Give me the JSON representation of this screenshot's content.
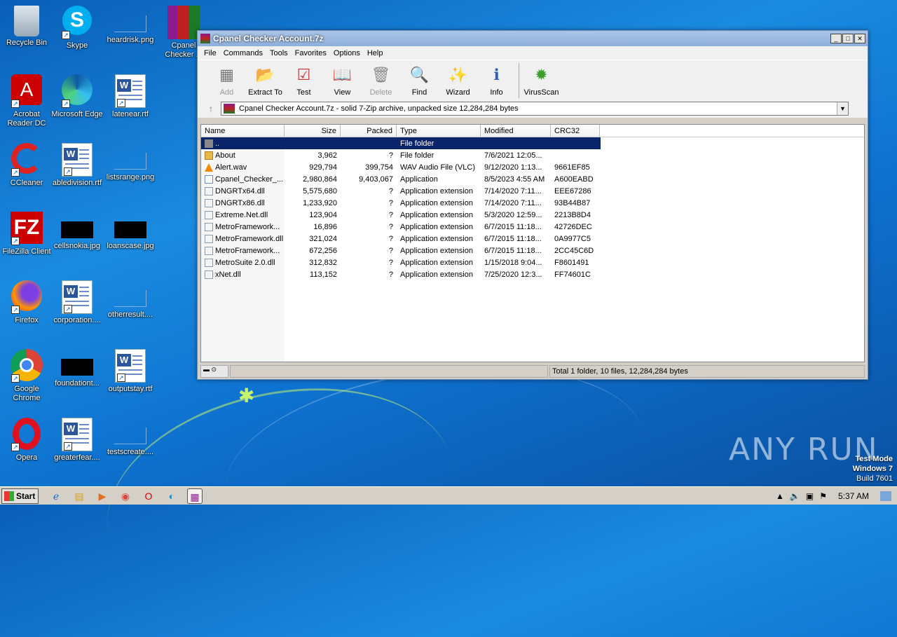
{
  "desktop": {
    "icons": [
      {
        "label": "Recycle Bin",
        "kind": "recycle"
      },
      {
        "label": "Skype",
        "kind": "skype"
      },
      {
        "label": "heardrisk.png",
        "kind": "blank"
      },
      {
        "label": "Cpanel Checker ...",
        "kind": "rar"
      },
      {
        "label": "Acrobat Reader DC",
        "kind": "acrobat"
      },
      {
        "label": "Microsoft Edge",
        "kind": "edge"
      },
      {
        "label": "latenear.rtf",
        "kind": "word"
      },
      {
        "label": "CCleaner",
        "kind": "ccleaner"
      },
      {
        "label": "abledivision.rtf",
        "kind": "word"
      },
      {
        "label": "listsrange.png",
        "kind": "blank"
      },
      {
        "label": "FileZilla Client",
        "kind": "filezilla"
      },
      {
        "label": "cellsnokia.jpg",
        "kind": "black"
      },
      {
        "label": "loanscase.jpg",
        "kind": "black"
      },
      {
        "label": "Firefox",
        "kind": "firefox"
      },
      {
        "label": "corporation....",
        "kind": "word"
      },
      {
        "label": "otherresult....",
        "kind": "blank"
      },
      {
        "label": "Google Chrome",
        "kind": "chrome"
      },
      {
        "label": "foundationt...",
        "kind": "black"
      },
      {
        "label": "outputstay.rtf",
        "kind": "word"
      },
      {
        "label": "Opera",
        "kind": "opera"
      },
      {
        "label": "greaterfear....",
        "kind": "word"
      },
      {
        "label": "testscreate....",
        "kind": "blank"
      }
    ]
  },
  "window": {
    "title": "Cpanel Checker Account.7z",
    "menu": [
      "File",
      "Commands",
      "Tools",
      "Favorites",
      "Options",
      "Help"
    ],
    "toolbar": [
      {
        "label": "Add",
        "icon": "add-icon",
        "disabled": true
      },
      {
        "label": "Extract To",
        "icon": "extract-icon",
        "disabled": false
      },
      {
        "label": "Test",
        "icon": "test-icon",
        "disabled": false
      },
      {
        "label": "View",
        "icon": "view-icon",
        "disabled": false
      },
      {
        "label": "Delete",
        "icon": "delete-icon",
        "disabled": true
      },
      {
        "label": "Find",
        "icon": "find-icon",
        "disabled": false
      },
      {
        "label": "Wizard",
        "icon": "wizard-icon",
        "disabled": false
      },
      {
        "label": "Info",
        "icon": "info-icon",
        "disabled": false
      },
      {
        "label": "VirusScan",
        "icon": "virusscan-icon",
        "disabled": false
      }
    ],
    "address": "Cpanel Checker Account.7z - solid 7-Zip archive, unpacked size 12,284,284 bytes",
    "columns": {
      "name": "Name",
      "size": "Size",
      "packed": "Packed",
      "type": "Type",
      "modified": "Modified",
      "crc": "CRC32"
    },
    "rows": [
      {
        "name": "..",
        "size": "",
        "packed": "",
        "type": "File folder",
        "modified": "",
        "crc": "",
        "icon": "up",
        "selected": true
      },
      {
        "name": "About",
        "size": "3,962",
        "packed": "?",
        "type": "File folder",
        "modified": "7/6/2021 12:05...",
        "crc": "",
        "icon": "folder"
      },
      {
        "name": "Alert.wav",
        "size": "929,794",
        "packed": "399,754",
        "type": "WAV Audio File (VLC)",
        "modified": "9/12/2020 1:13...",
        "crc": "9661EF85",
        "icon": "vlc"
      },
      {
        "name": "Cpanel_Checker_...",
        "size": "2,980,864",
        "packed": "9,403,067",
        "type": "Application",
        "modified": "8/5/2023 4:55 AM",
        "crc": "A600EABD",
        "icon": "app"
      },
      {
        "name": "DNGRTx64.dll",
        "size": "5,575,680",
        "packed": "?",
        "type": "Application extension",
        "modified": "7/14/2020 7:11...",
        "crc": "EEE67286",
        "icon": "dll"
      },
      {
        "name": "DNGRTx86.dll",
        "size": "1,233,920",
        "packed": "?",
        "type": "Application extension",
        "modified": "7/14/2020 7:11...",
        "crc": "93B44B87",
        "icon": "dll"
      },
      {
        "name": "Extreme.Net.dll",
        "size": "123,904",
        "packed": "?",
        "type": "Application extension",
        "modified": "5/3/2020 12:59...",
        "crc": "2213B8D4",
        "icon": "dll"
      },
      {
        "name": "MetroFramework...",
        "size": "16,896",
        "packed": "?",
        "type": "Application extension",
        "modified": "6/7/2015 11:18...",
        "crc": "42726DEC",
        "icon": "dll"
      },
      {
        "name": "MetroFramework.dll",
        "size": "321,024",
        "packed": "?",
        "type": "Application extension",
        "modified": "6/7/2015 11:18...",
        "crc": "0A9977C5",
        "icon": "dll"
      },
      {
        "name": "MetroFramework...",
        "size": "672,256",
        "packed": "?",
        "type": "Application extension",
        "modified": "6/7/2015 11:18...",
        "crc": "2CC45C6D",
        "icon": "dll"
      },
      {
        "name": "MetroSuite 2.0.dll",
        "size": "312,832",
        "packed": "?",
        "type": "Application extension",
        "modified": "1/15/2018 9:04...",
        "crc": "F8601491",
        "icon": "dll"
      },
      {
        "name": "xNet.dll",
        "size": "113,152",
        "packed": "?",
        "type": "Application extension",
        "modified": "7/25/2020 12:3...",
        "crc": "FF74601C",
        "icon": "dll"
      }
    ],
    "status": "Total 1 folder, 10 files, 12,284,284 bytes"
  },
  "watermark": {
    "brand": "ANY RUN",
    "line1": "Test Mode",
    "line2": "Windows 7",
    "line3": "Build 7601"
  },
  "taskbar": {
    "start": "Start",
    "clock": "5:37 AM"
  }
}
